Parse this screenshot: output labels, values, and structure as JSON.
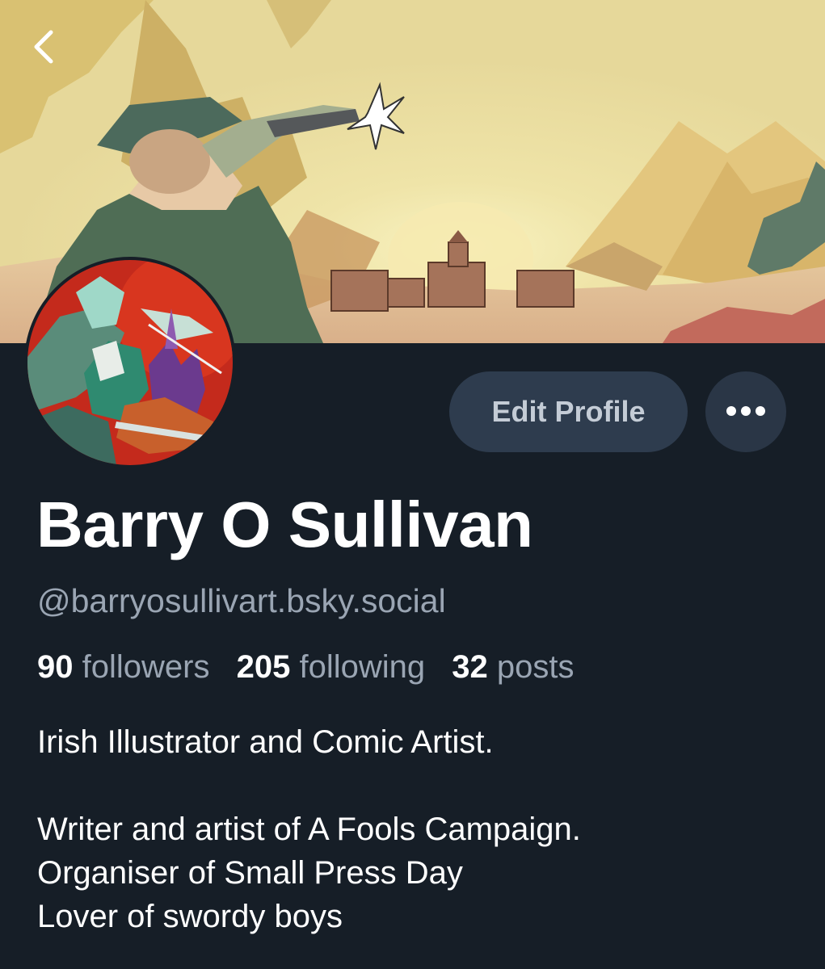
{
  "header": {
    "back_icon": "chevron-left-icon",
    "banner_description_icon": "banner-image"
  },
  "profile": {
    "display_name": "Barry O Sullivan",
    "handle": "@barryosullivart.bsky.social",
    "edit_label": "Edit Profile",
    "more_icon": "ellipsis-icon",
    "stats": {
      "followers_count": "90",
      "followers_label": "followers",
      "following_count": "205",
      "following_label": "following",
      "posts_count": "32",
      "posts_label": "posts"
    },
    "bio": {
      "line1": "Irish Illustrator and Comic Artist.",
      "line2": "Writer and artist of A Fools Campaign.",
      "line3": "Organiser of Small Press Day",
      "line4": "Lover of swordy boys"
    }
  },
  "colors": {
    "background": "#161e27",
    "button_bg": "#2e3c4e",
    "muted_text": "#9aa5b3"
  }
}
